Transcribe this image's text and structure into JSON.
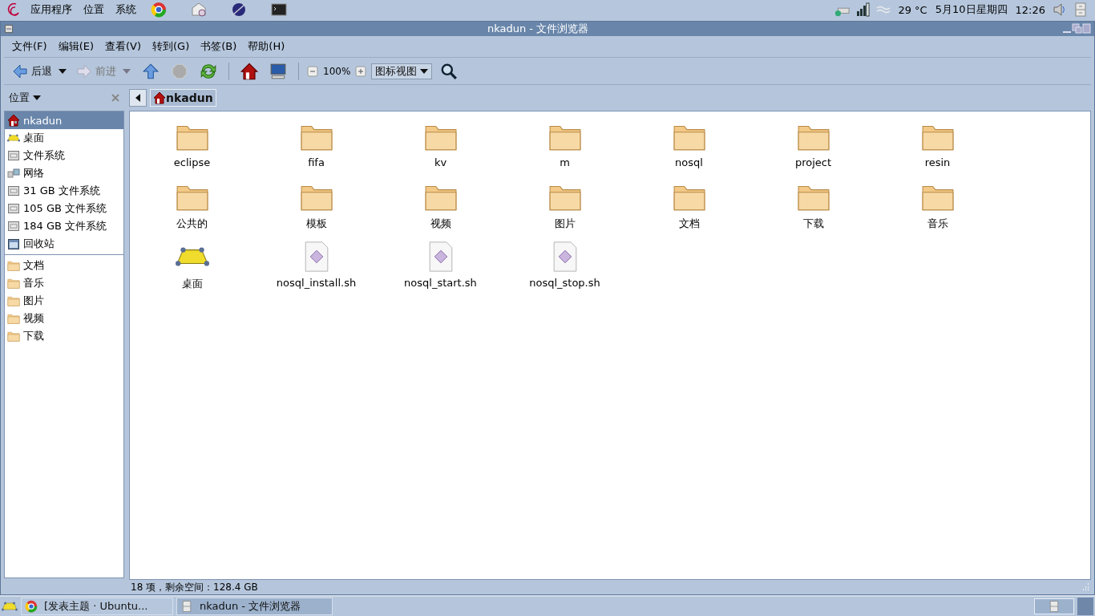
{
  "top_panel": {
    "menus": [
      "应用程序",
      "位置",
      "系统"
    ],
    "launchers": [
      {
        "kind": "browser"
      },
      {
        "kind": "mail"
      },
      {
        "kind": "globe"
      },
      {
        "kind": "terminal"
      }
    ],
    "temperature": "29 °C",
    "date": "5月10日星期四",
    "time": "12:26"
  },
  "window": {
    "title": "nkadun - 文件浏览器"
  },
  "menu_bar": [
    "文件(F)",
    "编辑(E)",
    "查看(V)",
    "转到(G)",
    "书签(B)",
    "帮助(H)"
  ],
  "toolbar": {
    "back": {
      "label": "后退",
      "disabled": false
    },
    "forward": {
      "label": "前进",
      "disabled": true
    },
    "zoom": "100%",
    "view": "图标视图"
  },
  "sidebar": {
    "title": "位置",
    "places": [
      {
        "kind": "home",
        "label": "nkadun",
        "selected": true
      },
      {
        "kind": "desktop",
        "label": "桌面",
        "selected": false
      },
      {
        "kind": "drive",
        "label": "文件系统",
        "selected": false
      },
      {
        "kind": "network",
        "label": "网络",
        "selected": false
      },
      {
        "kind": "drive",
        "label": "31 GB 文件系统",
        "selected": false
      },
      {
        "kind": "drive",
        "label": "105 GB 文件系统",
        "selected": false
      },
      {
        "kind": "drive",
        "label": "184 GB 文件系统",
        "selected": false
      },
      {
        "kind": "trash",
        "label": "回收站",
        "selected": false
      }
    ],
    "bookmarks": [
      {
        "kind": "folder",
        "label": "文档",
        "selected": false
      },
      {
        "kind": "folder",
        "label": "音乐",
        "selected": false
      },
      {
        "kind": "folder",
        "label": "图片",
        "selected": false
      },
      {
        "kind": "folder",
        "label": "视频",
        "selected": false
      },
      {
        "kind": "folder",
        "label": "下载",
        "selected": false
      }
    ]
  },
  "location": {
    "crumb": "nkadun"
  },
  "files": [
    {
      "kind": "folder",
      "name": "eclipse"
    },
    {
      "kind": "folder",
      "name": "fifa"
    },
    {
      "kind": "folder",
      "name": "kv"
    },
    {
      "kind": "folder",
      "name": "m"
    },
    {
      "kind": "folder",
      "name": "nosql"
    },
    {
      "kind": "folder",
      "name": "project"
    },
    {
      "kind": "folder",
      "name": "resin"
    },
    {
      "kind": "folder",
      "name": "公共的"
    },
    {
      "kind": "folder",
      "name": "模板"
    },
    {
      "kind": "folder",
      "name": "视频"
    },
    {
      "kind": "folder",
      "name": "图片"
    },
    {
      "kind": "folder",
      "name": "文档"
    },
    {
      "kind": "folder",
      "name": "下载"
    },
    {
      "kind": "folder",
      "name": "音乐"
    },
    {
      "kind": "desktop",
      "name": "桌面"
    },
    {
      "kind": "script",
      "name": "nosql_install.sh"
    },
    {
      "kind": "script",
      "name": "nosql_start.sh"
    },
    {
      "kind": "script",
      "name": "nosql_stop.sh"
    }
  ],
  "status_bar": "18 项，剩余空间：128.4 GB",
  "taskbar": [
    {
      "kind": "browser",
      "label": "[发表主题 · Ubuntu...",
      "selected": false
    },
    {
      "kind": "filer",
      "label": "nkadun - 文件浏览器",
      "selected": true
    }
  ]
}
